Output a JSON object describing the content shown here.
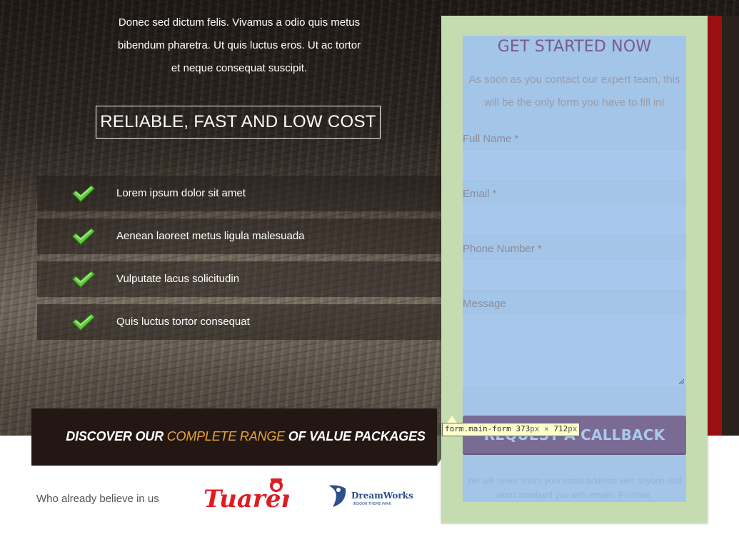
{
  "hero": {
    "intro_lines": [
      "Donec sed dictum felis. Vivamus a odio quis metus",
      "bibendum pharetra. Ut quis luctus eros. Ut ac tortor",
      "et neque consequat suscipit."
    ],
    "tagline": "RELIABLE, FAST AND LOW COST",
    "features": [
      {
        "label": "Lorem ipsum dolor sit amet",
        "icon": "check-icon"
      },
      {
        "label": "Aenean laoreet metus ligula malesuada",
        "icon": "check-icon"
      },
      {
        "label": "Vulputate lacus solicitudin",
        "icon": "check-icon"
      },
      {
        "label": "Quis luctus tortor consequat",
        "icon": "check-icon"
      }
    ]
  },
  "discover": {
    "prefix": "DISCOVER OUR",
    "highlight": "COMPLETE RANGE",
    "suffix": "OF VALUE PACKAGES",
    "highlight_color": "#e7a53d"
  },
  "partners": {
    "label": "Who already believe in us",
    "logos": [
      {
        "name": "Tuaren",
        "text": "Tuaren"
      },
      {
        "name": "DreamWorks Indoor Theme Park",
        "text": "DreamWorks",
        "subtext": "INDOOR THEME PARK"
      }
    ]
  },
  "form": {
    "title": "GET STARTED NOW",
    "subtitle_lines": [
      "As soon as you contact our expert team, this",
      "will be the only form you have to fill in!"
    ],
    "fields": [
      {
        "label": "Full Name *",
        "value": ""
      },
      {
        "label": "Email *",
        "value": ""
      },
      {
        "label": "Phone Number *",
        "value": ""
      },
      {
        "label": "Message",
        "value": ""
      }
    ],
    "submit_label": "REQUEST A CALLBACK",
    "privacy_lines": [
      "We will never share your email address with anyone and",
      "won't bombard you with emails. Promise."
    ]
  },
  "inspector": {
    "selector": "form.main-form",
    "width": "373",
    "height": "712",
    "unit": "px",
    "separator": "×"
  },
  "colors": {
    "accent_red": "#9a1010",
    "form_panel": "#c5dcb0",
    "form_overlay": "#a3c5e8",
    "button": "#7a6b95",
    "highlight": "#e7a53d"
  }
}
